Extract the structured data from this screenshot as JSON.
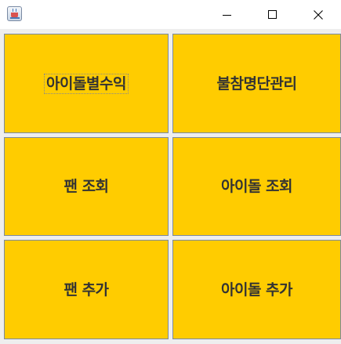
{
  "window": {
    "icon": "java-cup-icon",
    "controls": {
      "minimize": "minimize-icon",
      "maximize": "maximize-icon",
      "close": "close-icon"
    }
  },
  "buttons": [
    {
      "label": "아이돌별수익",
      "focused": true
    },
    {
      "label": "불참명단관리",
      "focused": false
    },
    {
      "label": "팬 조회",
      "focused": false
    },
    {
      "label": "아이돌 조회",
      "focused": false
    },
    {
      "label": "팬 추가",
      "focused": false
    },
    {
      "label": "아이돌 추가",
      "focused": false
    }
  ],
  "colors": {
    "button_background": "#ffcc00",
    "button_border": "#7b8aa2",
    "panel_background": "#eeeeee",
    "button_text": "#333333"
  }
}
